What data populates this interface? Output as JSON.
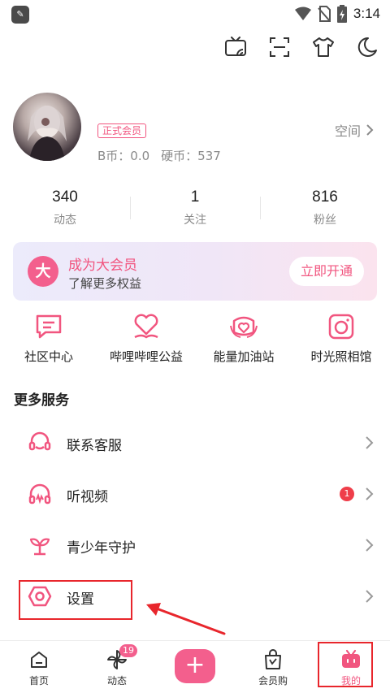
{
  "status_bar": {
    "time": "3:14"
  },
  "toolbar": {
    "icons": [
      "cast-icon",
      "scan-icon",
      "theme-shirt-icon",
      "night-mode-icon"
    ]
  },
  "profile": {
    "badge": "正式会员",
    "b_coin_label": "B币：0.0",
    "coin_label": "硬币：537",
    "space_link": "空间"
  },
  "stats": [
    {
      "value": "340",
      "label": "动态"
    },
    {
      "value": "1",
      "label": "关注"
    },
    {
      "value": "816",
      "label": "粉丝"
    }
  ],
  "vip_banner": {
    "logo": "大",
    "title": "成为大会员",
    "subtitle": "了解更多权益",
    "button": "立即开通"
  },
  "quick_actions": [
    {
      "label": "社区中心"
    },
    {
      "label": "哔哩哔哩公益"
    },
    {
      "label": "能量加油站"
    },
    {
      "label": "时光照相馆"
    }
  ],
  "more_services": {
    "title": "更多服务",
    "items": [
      {
        "label": "联系客服"
      },
      {
        "label": "听视频",
        "badge": "1"
      },
      {
        "label": "青少年守护"
      },
      {
        "label": "设置"
      }
    ]
  },
  "tabbar": {
    "items": [
      {
        "label": "首页"
      },
      {
        "label": "动态",
        "badge": "19"
      },
      {
        "label": "+"
      },
      {
        "label": "会员购"
      },
      {
        "label": "我的"
      }
    ]
  },
  "colors": {
    "accent": "#f1557f",
    "annotation": "#e8262c",
    "text": "#222222",
    "muted": "#8a8a8a"
  }
}
